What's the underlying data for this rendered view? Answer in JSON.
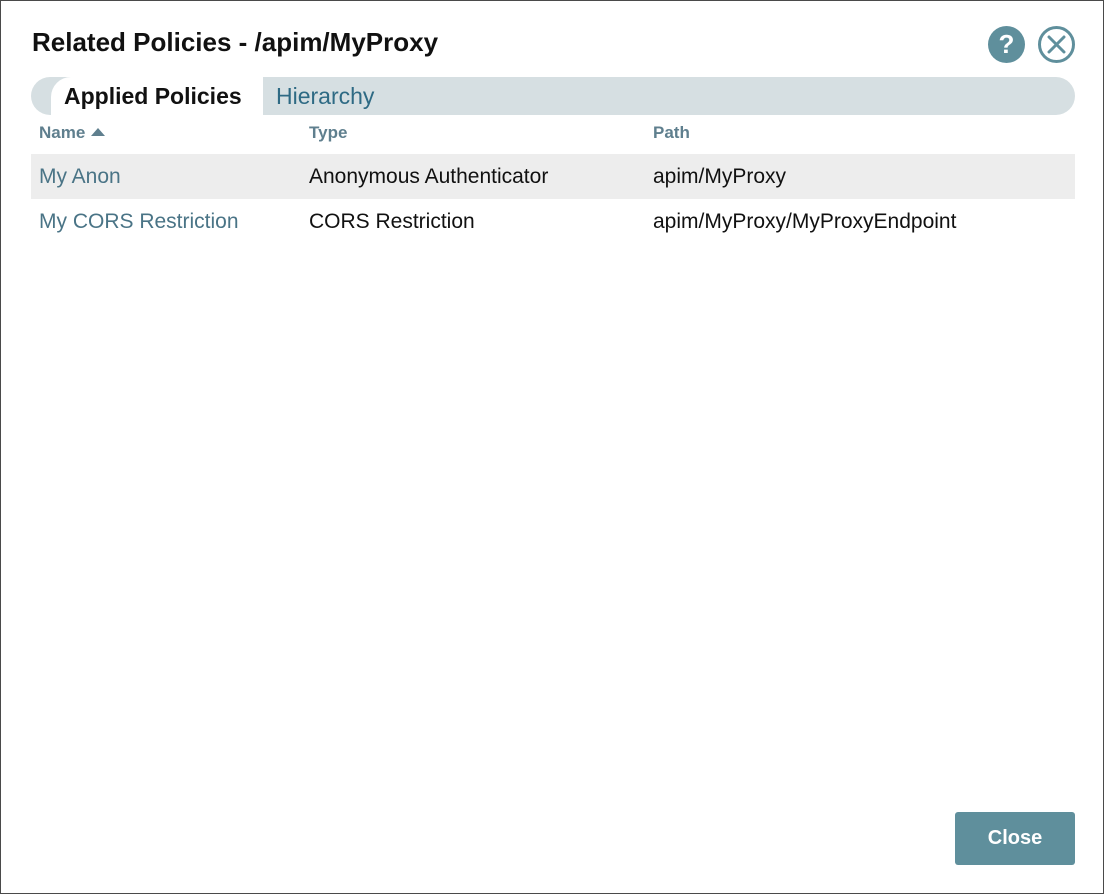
{
  "dialog": {
    "title": "Related Policies - /apim/MyProxy",
    "help_label": "?"
  },
  "tabs": [
    {
      "label": "Applied Policies",
      "active": true
    },
    {
      "label": "Hierarchy",
      "active": false
    }
  ],
  "table": {
    "columns": [
      "Name",
      "Type",
      "Path"
    ],
    "sort": {
      "column": "Name",
      "direction": "ascending"
    },
    "rows": [
      {
        "name": "My Anon",
        "type": "Anonymous Authenticator",
        "path": "apim/MyProxy"
      },
      {
        "name": "My CORS Restriction",
        "type": "CORS Restriction",
        "path": "apim/MyProxy/MyProxyEndpoint"
      }
    ]
  },
  "footer": {
    "close_label": "Close"
  },
  "colors": {
    "accent": "#5f8f9c",
    "link": "#4a7486",
    "tabbar": "#d6dfe2",
    "row_alt": "#ededed"
  },
  "icons": {
    "help": "question-circle-icon",
    "close": "close-circle-icon",
    "sort": "sort-ascending-icon"
  }
}
